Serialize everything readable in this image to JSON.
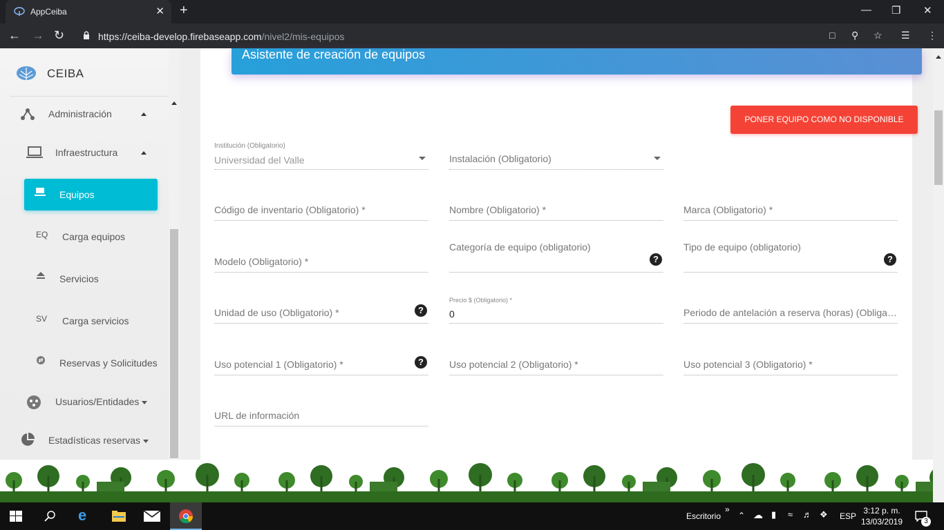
{
  "browser": {
    "tab_title": "AppCeiba",
    "tab_close": "✕",
    "new_tab": "+",
    "url_host": "https://ceiba-develop.firebaseapp.com",
    "url_path": "/nivel2/mis-equipos"
  },
  "sidebar": {
    "brand": "CEIBA",
    "items": [
      {
        "label": "Administración",
        "icon": "hierarchy-icon"
      },
      {
        "label": "Infraestructura",
        "icon": "laptop-icon"
      },
      {
        "label": "Equipos",
        "icon": "laptop-icon",
        "active": true
      },
      {
        "label": "Carga equipos",
        "abbr": "EQ"
      },
      {
        "label": "Servicios",
        "icon": "eject-icon"
      },
      {
        "label": "Carga servicios",
        "abbr": "SV"
      },
      {
        "label": "Reservas y Solicitudes",
        "icon": "swap-icon"
      },
      {
        "label": "Usuarios/Entidades",
        "icon": "people-icon"
      },
      {
        "label": "Estadísticas reservas",
        "icon": "pie-chart-icon"
      }
    ]
  },
  "main": {
    "header_title": "Asistente de creación de equipos",
    "unavailable_button": "PONER EQUIPO COMO NO DISPONIBLE",
    "fields": {
      "institucion_label": "Institución (Obligatorio)",
      "institucion_value": "Universidad del Valle",
      "instalacion": "Instalación (Obligatorio)",
      "codigo": "Código de inventario (Obligatorio) *",
      "nombre": "Nombre (Obligatorio) *",
      "marca": "Marca (Obligatorio) *",
      "modelo": "Modelo (Obligatorio) *",
      "categoria": "Categoría de equipo (obligatorio)",
      "tipo": "Tipo de equipo (obligatorio)",
      "unidad": "Unidad de uso (Obligatorio) *",
      "precio_label": "Precio $ (Obligatorio) *",
      "precio_value": "0",
      "periodo": "Periodo de antelación a reserva (horas) (Obligatorio) *",
      "uso1": "Uso potencial 1 (Obligatorio) *",
      "uso2": "Uso potencial 2 (Obligatorio) *",
      "uso3": "Uso potencial 3 (Obligatorio) *",
      "url": "URL de información"
    },
    "help_glyph": "?"
  },
  "taskbar": {
    "desktop": "Escritorio",
    "chevron": "»",
    "lang": "ESP",
    "time": "3:12 p. m.",
    "date": "13/03/2019",
    "notifications": "3"
  },
  "colors": {
    "accent": "#00bcd4",
    "danger": "#f44336",
    "header_from": "#26a0da",
    "header_to": "#5b8fd3"
  }
}
